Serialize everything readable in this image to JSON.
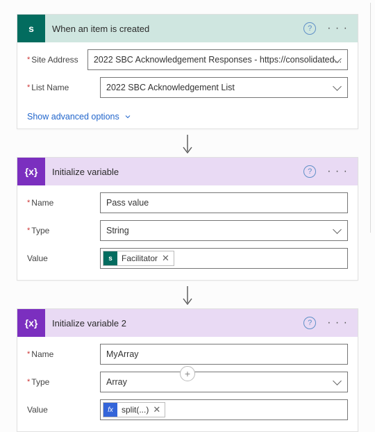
{
  "cards": {
    "trigger": {
      "title": "When an item is created",
      "fields": {
        "siteAddress": {
          "label": "Site Address",
          "value": "2022 SBC Acknowledgement Responses - https://consolidated..."
        },
        "listName": {
          "label": "List Name",
          "value": "2022 SBC Acknowledgement List"
        }
      },
      "advancedLink": "Show advanced options"
    },
    "initVar1": {
      "title": "Initialize variable",
      "fields": {
        "name": {
          "label": "Name",
          "value": "Pass value"
        },
        "type": {
          "label": "Type",
          "value": "String"
        },
        "value": {
          "label": "Value",
          "tokenLabel": "Facilitator"
        }
      }
    },
    "initVar2": {
      "title": "Initialize variable 2",
      "fields": {
        "name": {
          "label": "Name",
          "value": "MyArray"
        },
        "type": {
          "label": "Type",
          "value": "Array"
        },
        "value": {
          "label": "Value",
          "tokenLabel": "split(...)"
        }
      }
    }
  },
  "icons": {
    "sharepointGlyph": "s",
    "variableGlyph": "{x}",
    "fxGlyph": "fx",
    "help": "?",
    "more": "· · ·",
    "tokenClose": "✕",
    "plus": "+"
  }
}
